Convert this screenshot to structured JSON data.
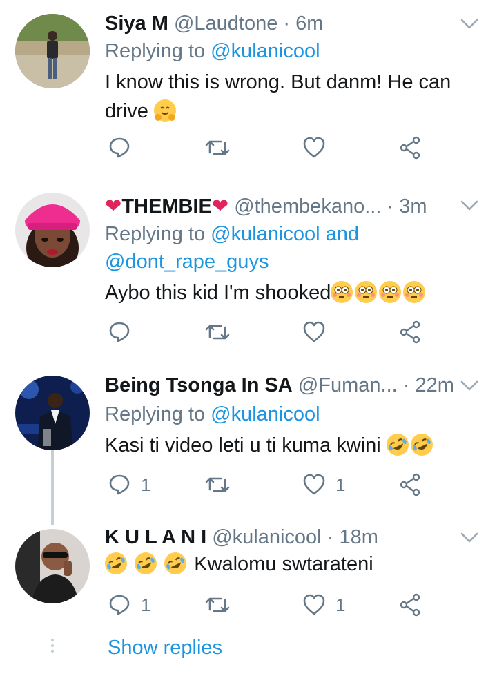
{
  "tweets": [
    {
      "name": "Siya M",
      "handle": "@Laudtone",
      "time": "6m",
      "replying_prefix": "Replying to",
      "replying_mentions": "@kulanicool",
      "text_line1": "I know this is wrong. But danm! He can",
      "text_line2": "drive",
      "emoji": "hugging-face",
      "reply_count": "",
      "like_count": ""
    },
    {
      "name": "THEMBIE",
      "handle": "@thembekano...",
      "time": "3m",
      "replying_prefix": "Replying to",
      "replying_mentions": "@kulanicool and",
      "replying_mentions2": "@dont_rape_guys",
      "text": "Aybo this kid I'm shooked",
      "emoji": "flushed-face",
      "reply_count": "",
      "like_count": ""
    },
    {
      "name": "Being Tsonga In SA",
      "handle": "@Fuman...",
      "time": "22m",
      "replying_prefix": "Replying to",
      "replying_mentions": "@kulanicool",
      "text": "Kasi ti video leti u ti kuma kwini",
      "emoji": "rolling-on-floor-laughing",
      "reply_count": "1",
      "like_count": "1"
    },
    {
      "name": "K U L A N I",
      "handle": "@kulanicool",
      "time": "18m",
      "text": "Kwalomu swtarateni",
      "emoji": "rolling-on-floor-laughing",
      "reply_count": "1",
      "like_count": "1"
    }
  ],
  "show_replies": "Show replies",
  "colors": {
    "accent": "#1b95e0",
    "secondary_text": "#657786",
    "divider": "#e1e8ed",
    "heart_red": "#e0245e"
  }
}
